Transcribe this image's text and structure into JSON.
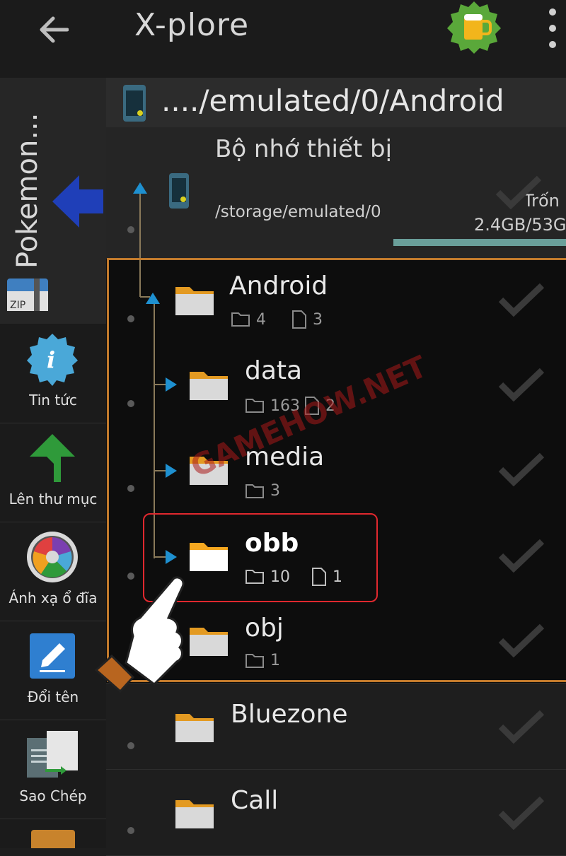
{
  "app": {
    "title": "X-plore"
  },
  "sidebar": {
    "tab_label": "Pokemon...",
    "zip_label": "ZIP",
    "tools": [
      {
        "label": "Tin tức",
        "icon": "info-icon"
      },
      {
        "label": "Lên thư mục",
        "icon": "up-folder-arrow-icon"
      },
      {
        "label": "Ánh xạ ổ đĩa",
        "icon": "disk-map-icon"
      },
      {
        "label": "Đổi tên",
        "icon": "rename-pencil-icon"
      },
      {
        "label": "Sao Chép",
        "icon": "copy-icon"
      }
    ]
  },
  "path_header": {
    "text": "..../emulated/0/Android"
  },
  "device": {
    "name": "Bộ nhớ thiết bị",
    "path": "/storage/emulated/0",
    "free_label": "Trốn",
    "size": "2.4GB/53G"
  },
  "folders": [
    {
      "name": "Android",
      "folders": "4",
      "files": "3"
    },
    {
      "name": "data",
      "folders": "163",
      "files": "2"
    },
    {
      "name": "media",
      "folders": "3",
      "files": ""
    },
    {
      "name": "obb",
      "folders": "10",
      "files": "1"
    },
    {
      "name": "obj",
      "folders": "1",
      "files": ""
    },
    {
      "name": "Bluezone",
      "folders": "",
      "files": ""
    },
    {
      "name": "Call",
      "folders": "",
      "files": ""
    }
  ],
  "watermark": "GAMEHOW.NET",
  "colors": {
    "accent_orange": "#c27a2c",
    "highlight_red": "#e0282e",
    "tree_blue": "#1e90d0",
    "folder_yellow": "#f0a020"
  }
}
